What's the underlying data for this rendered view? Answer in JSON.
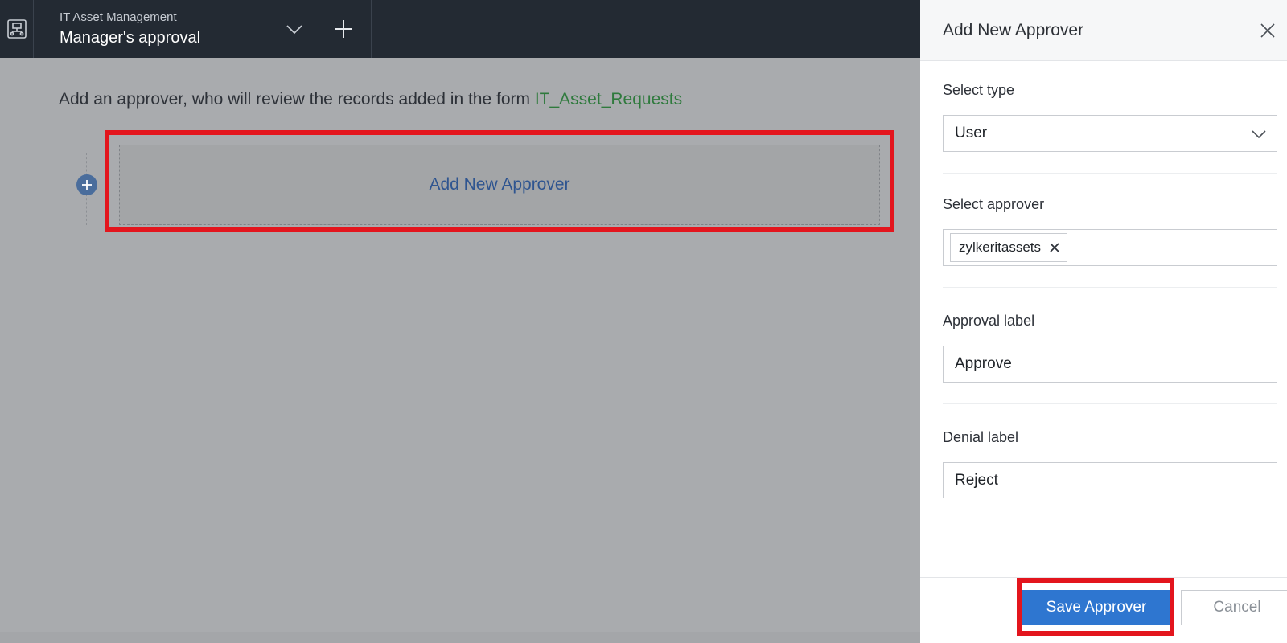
{
  "header": {
    "app_name": "IT Asset Management",
    "page_name": "Manager's approval",
    "icons": {
      "app": "flowchart-icon",
      "dropdown": "chevron-down-icon",
      "add": "plus-icon"
    }
  },
  "main": {
    "intro_text": "Add an approver, who will review the records added in the form ",
    "form_name": "IT_Asset_Requests",
    "add_approver_label": "Add New Approver"
  },
  "panel": {
    "title": "Add New Approver",
    "select_type": {
      "label": "Select type",
      "value": "User"
    },
    "select_approver": {
      "label": "Select approver",
      "chip": "zylkeritassets"
    },
    "approval_label": {
      "label": "Approval label",
      "value": "Approve"
    },
    "denial_label": {
      "label": "Denial label",
      "value": "Reject"
    },
    "save_label": "Save Approver",
    "cancel_label": "Cancel"
  },
  "colors": {
    "accent": "#2e76d0",
    "highlight": "#e3151d",
    "form_link": "#2f7a3d",
    "topbar": "#232a33"
  }
}
